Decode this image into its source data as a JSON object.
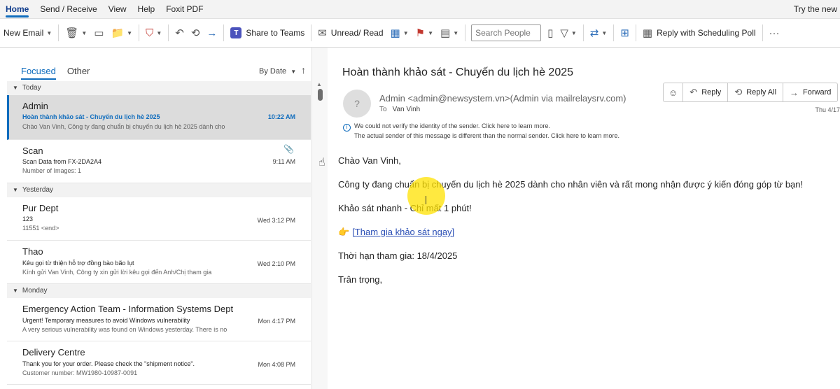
{
  "menu": {
    "tabs": [
      "Home",
      "Send / Receive",
      "View",
      "Help",
      "Foxit PDF"
    ],
    "try_new": "Try the new"
  },
  "ribbon": {
    "new_email": "New Email",
    "share_teams": "Share to Teams",
    "unread_read": "Unread/ Read",
    "search_people_placeholder": "Search People",
    "reply_poll": "Reply with Scheduling Poll"
  },
  "list": {
    "focused": "Focused",
    "other": "Other",
    "sort": "By Date",
    "groups": {
      "today": "Today",
      "yesterday": "Yesterday",
      "monday": "Monday"
    },
    "messages": [
      {
        "sender": "Admin",
        "subject": "Hoàn thành khảo sát - Chuyến du lịch hè 2025",
        "preview": "Chào Van Vinh,    Công ty đang chuẩn bị chuyến du lịch hè 2025 dành cho",
        "time": "10:22 AM"
      },
      {
        "sender": "Scan",
        "subject": "Scan Data from FX-2DA2A4",
        "preview": "Number of Images: 1",
        "time": "9:11 AM"
      },
      {
        "sender": "Pur Dept",
        "subject": "123",
        "preview": "11551 <end>",
        "time": "Wed 3:12 PM"
      },
      {
        "sender": "Thao",
        "subject": "Kêu gọi từ thiện hỗ trợ đồng bào bão lụt",
        "preview": "Kính gửi Van Vinh,    Công ty xin gửi lời kêu gọi đến Anh/Chị tham gia",
        "time": "Wed 2:10 PM"
      },
      {
        "sender": "Emergency Action Team - Information Systems Dept",
        "subject": "Urgent! Temporary measures to avoid Windows  vulnerability",
        "preview": "A very serious vulnerability was found on Windows yesterday.   There is no",
        "time": "Mon 4:17 PM"
      },
      {
        "sender": "Delivery Centre",
        "subject": "Thank you for your order. Please check the \"shipment notice\".",
        "preview": "Customer number: MW1980-10987-0091",
        "time": "Mon 4:08 PM"
      }
    ]
  },
  "reading": {
    "subject": "Hoàn thành khảo sát - Chuyến du lịch hè 2025",
    "avatar": "?",
    "from": "Admin <admin@newsystem.vn>(Admin via mailrelaysrv.com)",
    "to_label": "To",
    "to_name": "Van Vinh",
    "date": "Thu 4/17",
    "actions": {
      "reply": "Reply",
      "reply_all": "Reply All",
      "forward": "Forward"
    },
    "warning_1": "We could not verify the identity of the sender. Click here to learn more.",
    "warning_2": "The actual sender of this message is different than the normal sender. Click here to learn more.",
    "body": {
      "greeting": "Chào Van Vinh,",
      "line1": "Công ty đang chuẩn bị chuyến du lịch hè 2025 dành cho nhân viên và rất mong nhận được ý kiến đóng góp từ bạn!",
      "line2": "Khảo sát nhanh - Chỉ mất 1 phút!",
      "link": "[Tham gia khảo sát ngay]",
      "deadline": "Thời hạn tham gia: 18/4/2025",
      "closing": "Trân trọng,"
    }
  }
}
